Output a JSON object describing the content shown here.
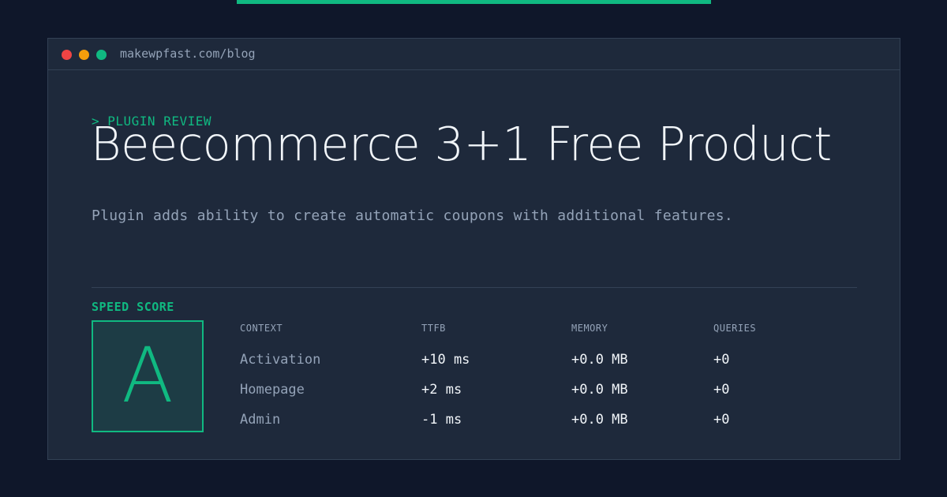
{
  "window": {
    "url": "makewpfast.com/blog"
  },
  "post": {
    "kicker": "> PLUGIN REVIEW",
    "title": "Beecommerce 3+1 Free Product",
    "description": "Plugin adds ability to create automatic coupons with additional features."
  },
  "score": {
    "label": "SPEED SCORE",
    "grade": "A"
  },
  "metrics": {
    "headers": [
      "CONTEXT",
      "TTFB",
      "MEMORY",
      "QUERIES"
    ],
    "rows": [
      [
        "Activation",
        "+10 ms",
        "+0.0 MB",
        "+0"
      ],
      [
        "Homepage",
        "+2 ms",
        "+0.0 MB",
        "+0"
      ],
      [
        "Admin",
        "-1 ms",
        "+0.0 MB",
        "+0"
      ]
    ]
  },
  "colors": {
    "accent": "#10b981",
    "background": "#0f172a",
    "panel": "#1e293b"
  }
}
